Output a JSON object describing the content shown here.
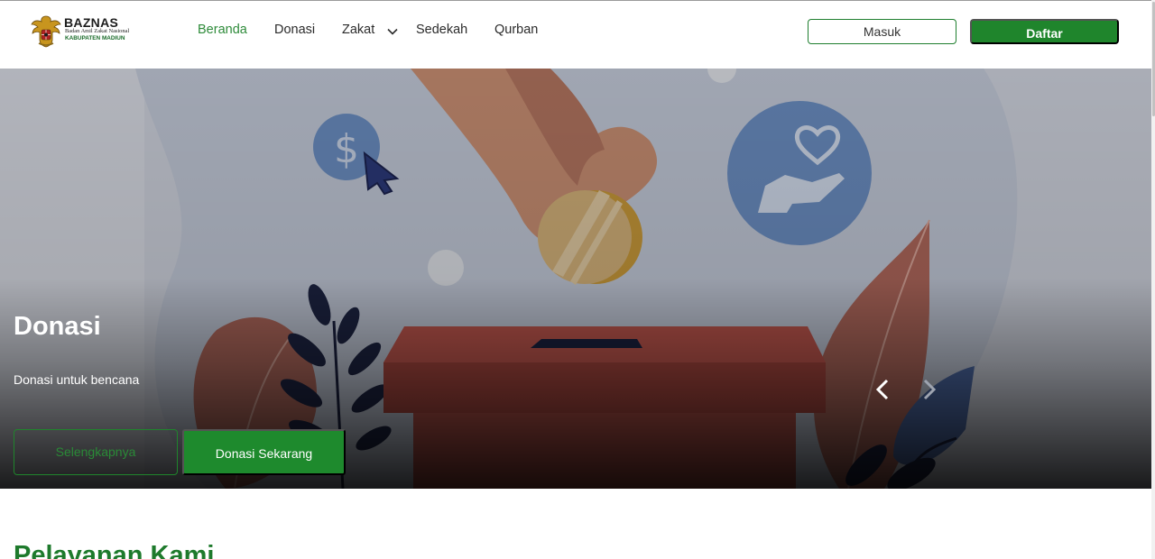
{
  "brand": {
    "name": "BAZNAS",
    "subtitle": "Badan Amil Zakat Nasional",
    "region": "KABUPATEN MADIUN",
    "logo_icon": "garuda-emblem-icon"
  },
  "nav": {
    "items": [
      {
        "label": "Beranda",
        "active": true
      },
      {
        "label": "Donasi",
        "active": false
      },
      {
        "label": "Zakat",
        "active": false,
        "has_dropdown": true
      },
      {
        "label": "Sedekah",
        "active": false
      },
      {
        "label": "Qurban",
        "active": false
      }
    ],
    "dropdown_icon": "chevron-down-icon"
  },
  "auth": {
    "login_label": "Masuk",
    "register_label": "Daftar"
  },
  "hero": {
    "title": "Donasi",
    "description": "Donasi untuk bencana",
    "more_label": "Selengkapnya",
    "donate_label": "Donasi Sekarang",
    "prev_icon": "chevron-left-icon",
    "next_icon": "chevron-right-icon"
  },
  "section": {
    "title": "Pelayanan Kami"
  },
  "colors": {
    "brand_green": "#1f852c",
    "active_nav": "#2e8b3a",
    "hero_overlay": "#000000"
  }
}
